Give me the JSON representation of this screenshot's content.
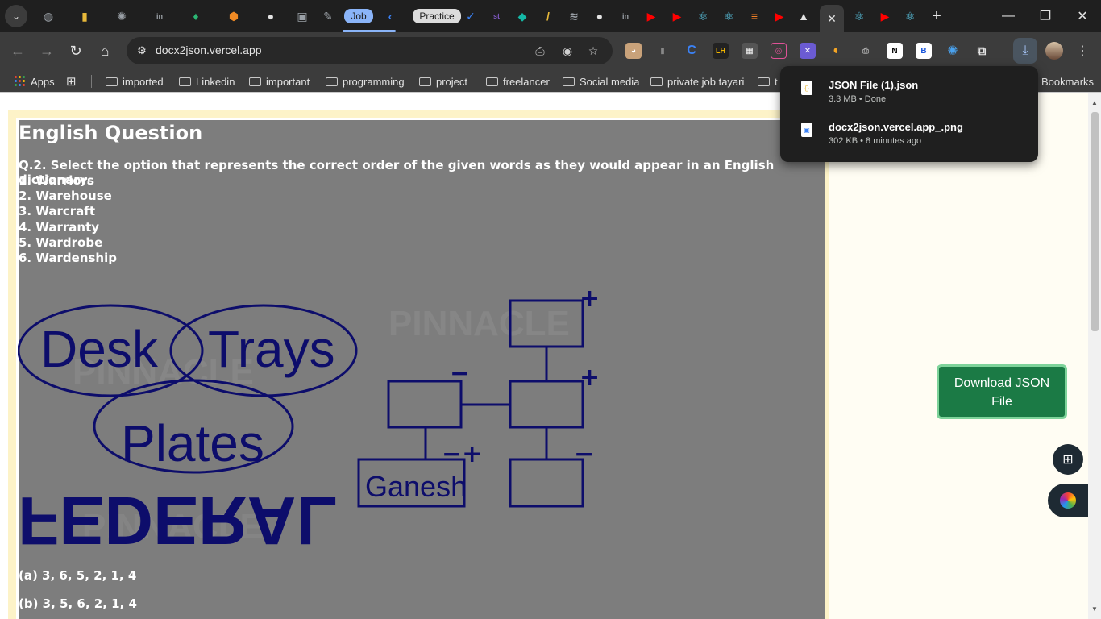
{
  "browser": {
    "tabs": [
      {
        "icon": "globe-icon",
        "color": "#9aa0a6",
        "glyph": "◍"
      },
      {
        "icon": "notes-icon",
        "color": "#e8b93a",
        "glyph": "▮"
      },
      {
        "icon": "openai-icon",
        "color": "#9aa0a6",
        "glyph": "✺"
      },
      {
        "icon": "linkedin-icon",
        "color": "#9aa0a6",
        "glyph": "in"
      },
      {
        "icon": "leaf-icon",
        "color": "#2bb673",
        "glyph": "♦"
      },
      {
        "icon": "cube-icon",
        "color": "#f08a24",
        "glyph": "⬢"
      },
      {
        "icon": "github-icon",
        "color": "#e3e3e3",
        "glyph": "●"
      },
      {
        "icon": "square-icon",
        "color": "#9aa0a6",
        "glyph": "▣"
      },
      {
        "icon": "pen-icon",
        "color": "#9aa0a6",
        "glyph": "✎"
      },
      {
        "icon": "bookmark-icon",
        "color": "#3b82f6",
        "glyph": "‹"
      },
      {
        "icon": "check-icon",
        "color": "#3b82f6",
        "glyph": "✓"
      },
      {
        "icon": "st-icon",
        "color": "#7e57c2",
        "glyph": "st"
      },
      {
        "icon": "diamond-icon",
        "color": "#14b8a6",
        "glyph": "◆"
      },
      {
        "icon": "slash-icon",
        "color": "#e8b93a",
        "glyph": "/"
      },
      {
        "icon": "wave-icon",
        "color": "#9aa0a6",
        "glyph": "≋"
      },
      {
        "icon": "github-icon",
        "color": "#e3e3e3",
        "glyph": "●"
      },
      {
        "icon": "linkedin-icon",
        "color": "#9aa0a6",
        "glyph": "in"
      },
      {
        "icon": "youtube-icon",
        "color": "#ff0000",
        "glyph": "▶"
      },
      {
        "icon": "youtube-icon",
        "color": "#ff0000",
        "glyph": "▶"
      },
      {
        "icon": "react-icon",
        "color": "#61dafb",
        "glyph": "⚛"
      },
      {
        "icon": "react-icon",
        "color": "#61dafb",
        "glyph": "⚛"
      },
      {
        "icon": "stack-icon",
        "color": "#f48024",
        "glyph": "≡"
      },
      {
        "icon": "youtube-icon",
        "color": "#ff0000",
        "glyph": "▶"
      },
      {
        "icon": "triangle-icon",
        "color": "#e3e3e3",
        "glyph": "▲"
      },
      {
        "icon": "close-icon",
        "color": "#e3e3e3",
        "glyph": "✕"
      },
      {
        "icon": "react-icon",
        "color": "#61dafb",
        "glyph": "⚛"
      },
      {
        "icon": "youtube-icon",
        "color": "#ff0000",
        "glyph": "▶"
      },
      {
        "icon": "react-icon",
        "color": "#61dafb",
        "glyph": "⚛"
      }
    ],
    "pill_tabs": {
      "job": "Job",
      "practice": "Practice"
    },
    "url": "docx2json.vercel.app",
    "bookmarks": {
      "apps": "Apps",
      "folders": [
        "imported",
        "Linkedin",
        "important",
        "programming",
        "project",
        "freelancer",
        "Social media",
        "private job tayari",
        "t"
      ],
      "all": "Bookmarks"
    }
  },
  "downloads": [
    {
      "name": "JSON File (1).json",
      "meta": "3.3 MB • Done"
    },
    {
      "name": "docx2json.vercel.app_.png",
      "meta": "302 KB • 8 minutes ago"
    }
  ],
  "question": {
    "title": "English Question",
    "text": "Q.2. Select the option that represents the correct order of the given words as they would appear in an English dictionary.",
    "words": [
      "1. Warriors",
      "2. Warehouse",
      "3. Warcraft",
      "4. Warranty",
      "5. Wardrobe",
      "6. Wardenship"
    ],
    "options": [
      "(a) 3, 6, 5, 2, 1, 4",
      "(b) 3, 5, 6, 2, 1, 4"
    ]
  },
  "figure": {
    "venn": [
      "Desk",
      "Trays",
      "Plates"
    ],
    "box_label": "Ganesh",
    "mirror_word": "FEDERAL",
    "watermark": "PINNACLE",
    "signs": [
      "+",
      "+",
      "−",
      "−+",
      "−"
    ]
  },
  "actions": {
    "download_json": "Download JSON File"
  },
  "colors": {
    "accent_green": "#1b7a45",
    "figure_navy": "#0d0d6b",
    "preview_gray": "#7d7d7d"
  }
}
